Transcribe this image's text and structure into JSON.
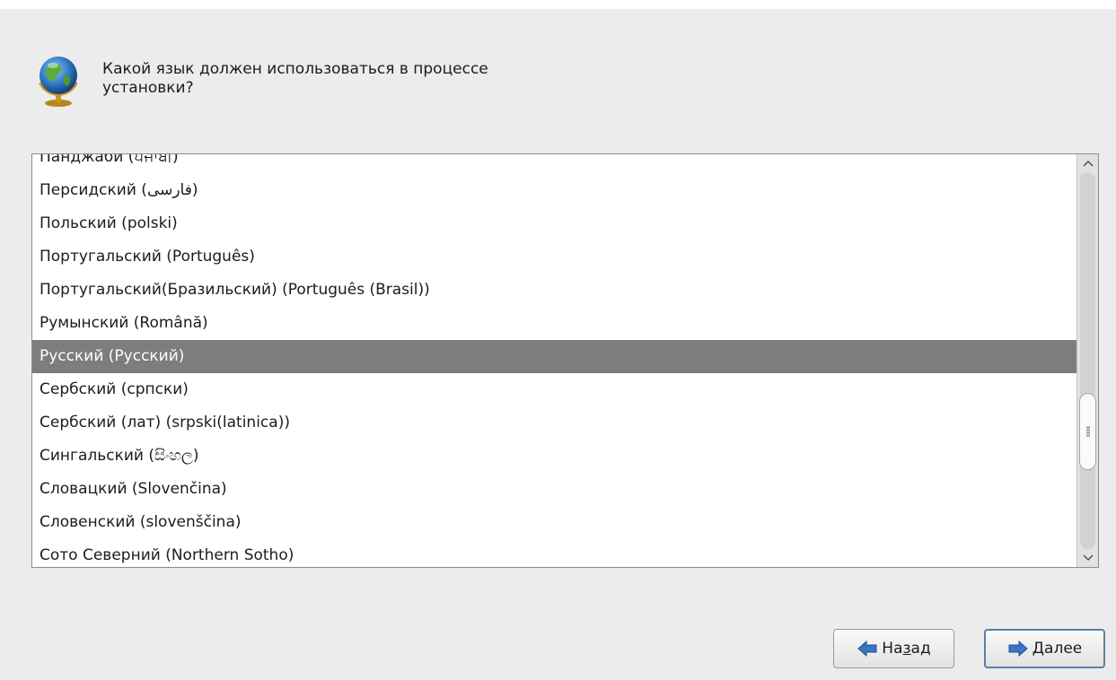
{
  "header": {
    "question_line1": "Какой язык должен использоваться в процессе",
    "question_line2": "установки?"
  },
  "languages": [
    "Панджаби (ਪੰਜਾਬੀ)",
    "Персидский (فارسی)",
    "Польский (polski)",
    "Португальский (Português)",
    "Португальский(Бразильский) (Português (Brasil))",
    "Румынский (Română)",
    "Русский (Русский)",
    "Сербский (српски)",
    "Сербский (лат) (srpski(latinica))",
    "Сингальский (සිංහල)",
    "Словацкий (Slovenčina)",
    "Словенский (slovenščina)",
    "Сото Северний (Northern Sotho)"
  ],
  "selected_index": 6,
  "buttons": {
    "back": {
      "before": "На",
      "mnemonic": "з",
      "after": "ад"
    },
    "next": {
      "before": "",
      "mnemonic": "Д",
      "after": "алее"
    }
  },
  "icons": {
    "header": "globe-icon",
    "back": "arrow-left-icon",
    "next": "arrow-right-icon",
    "scroll_up": "scroll-up-arrow-icon",
    "scroll_down": "scroll-down-arrow-icon"
  },
  "colors": {
    "selection": "#7d7d7d",
    "arrow_blue": "#3b74c0",
    "default_border": "#5a7fa8"
  }
}
